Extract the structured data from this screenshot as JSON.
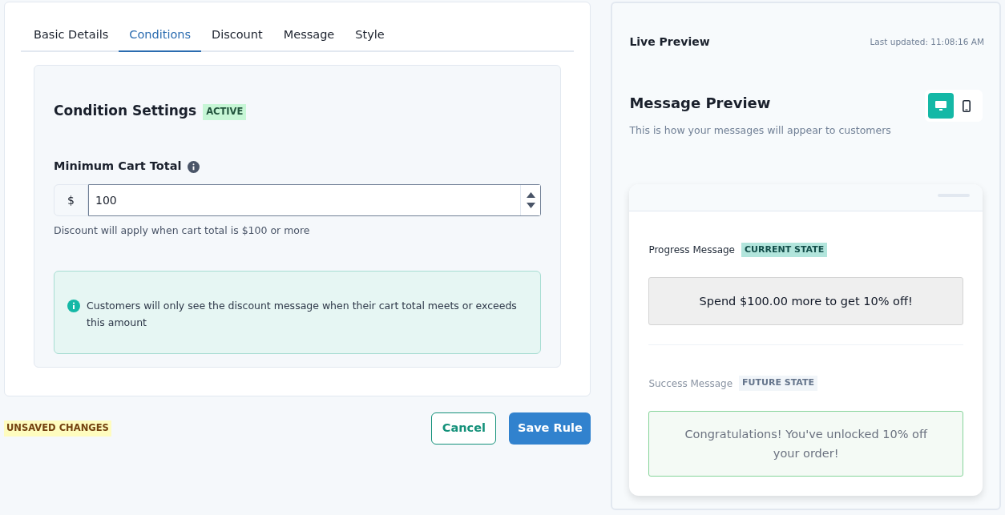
{
  "tabs": [
    {
      "label": "Basic Details",
      "selected": false
    },
    {
      "label": "Conditions",
      "selected": true
    },
    {
      "label": "Discount",
      "selected": false
    },
    {
      "label": "Message",
      "selected": false
    },
    {
      "label": "Style",
      "selected": false
    }
  ],
  "section": {
    "title": "Condition Settings",
    "badge": "ACTIVE"
  },
  "field": {
    "label": "Minimum Cart Total",
    "prefix": "$",
    "value": "100",
    "help": "Discount will apply when cart total is $100 or more"
  },
  "note": "Customers will only see the discount message when their cart total meets or exceeds this amount",
  "status_badge": "UNSAVED CHANGES",
  "buttons": [
    {
      "label": "Cancel",
      "kind": "secondary"
    },
    {
      "label": "Save Rule",
      "kind": "primary"
    }
  ],
  "preview": {
    "title": "Live Preview",
    "last_updated": "Last updated: 11:08:16 AM",
    "heading": "Message Preview",
    "subtitle": "This is how your messages will appear to customers",
    "devices": [
      {
        "kind": "desktop",
        "selected": true
      },
      {
        "kind": "mobile",
        "selected": false
      }
    ],
    "messages": [
      {
        "label": "Progress Message",
        "badge": "CURRENT STATE",
        "kind": "current",
        "text": "Spend $100.00 more to get 10% off!"
      },
      {
        "label": "Success Message",
        "badge": "FUTURE STATE",
        "kind": "future",
        "text": "Congratulations! You've unlocked 10% off your order!"
      }
    ]
  }
}
